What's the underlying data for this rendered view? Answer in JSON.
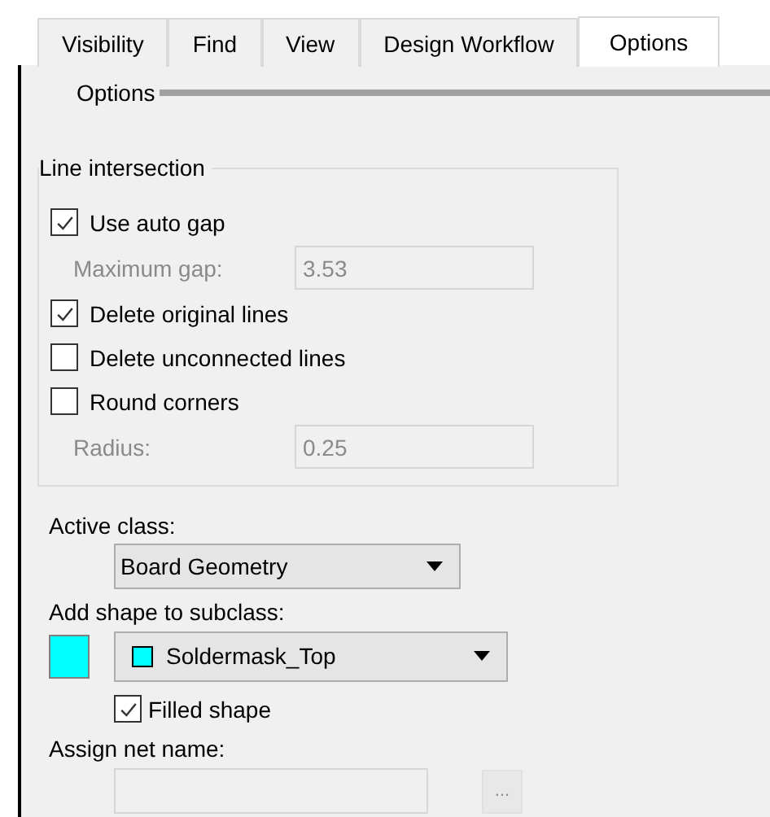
{
  "tabs": [
    {
      "label": "Visibility",
      "selected": false
    },
    {
      "label": "Find",
      "selected": false
    },
    {
      "label": "View",
      "selected": false
    },
    {
      "label": "Design Workflow",
      "selected": false
    },
    {
      "label": "Options",
      "selected": true
    }
  ],
  "section_title": "Options",
  "line_intersection": {
    "title": "Line intersection",
    "rows": [
      {
        "kind": "checkbox",
        "label": "Use auto gap",
        "checked": true
      },
      {
        "kind": "field",
        "label": "Maximum gap:",
        "value": "3.53",
        "disabled": true
      },
      {
        "kind": "checkbox",
        "label": "Delete original lines",
        "checked": true
      },
      {
        "kind": "checkbox",
        "label": "Delete unconnected lines",
        "checked": false
      },
      {
        "kind": "checkbox",
        "label": "Round corners",
        "checked": false
      },
      {
        "kind": "field",
        "label": "Radius:",
        "value": "0.25",
        "disabled": true
      }
    ]
  },
  "active_class": {
    "label": "Active class:",
    "value": "Board Geometry"
  },
  "subclass": {
    "label": "Add shape to subclass:",
    "color": "#00ffff",
    "value": "Soldermask_Top"
  },
  "filled_shape": {
    "label": "Filled shape",
    "checked": true
  },
  "net_name": {
    "label": "Assign net name:",
    "disabled": true,
    "button": "..."
  }
}
